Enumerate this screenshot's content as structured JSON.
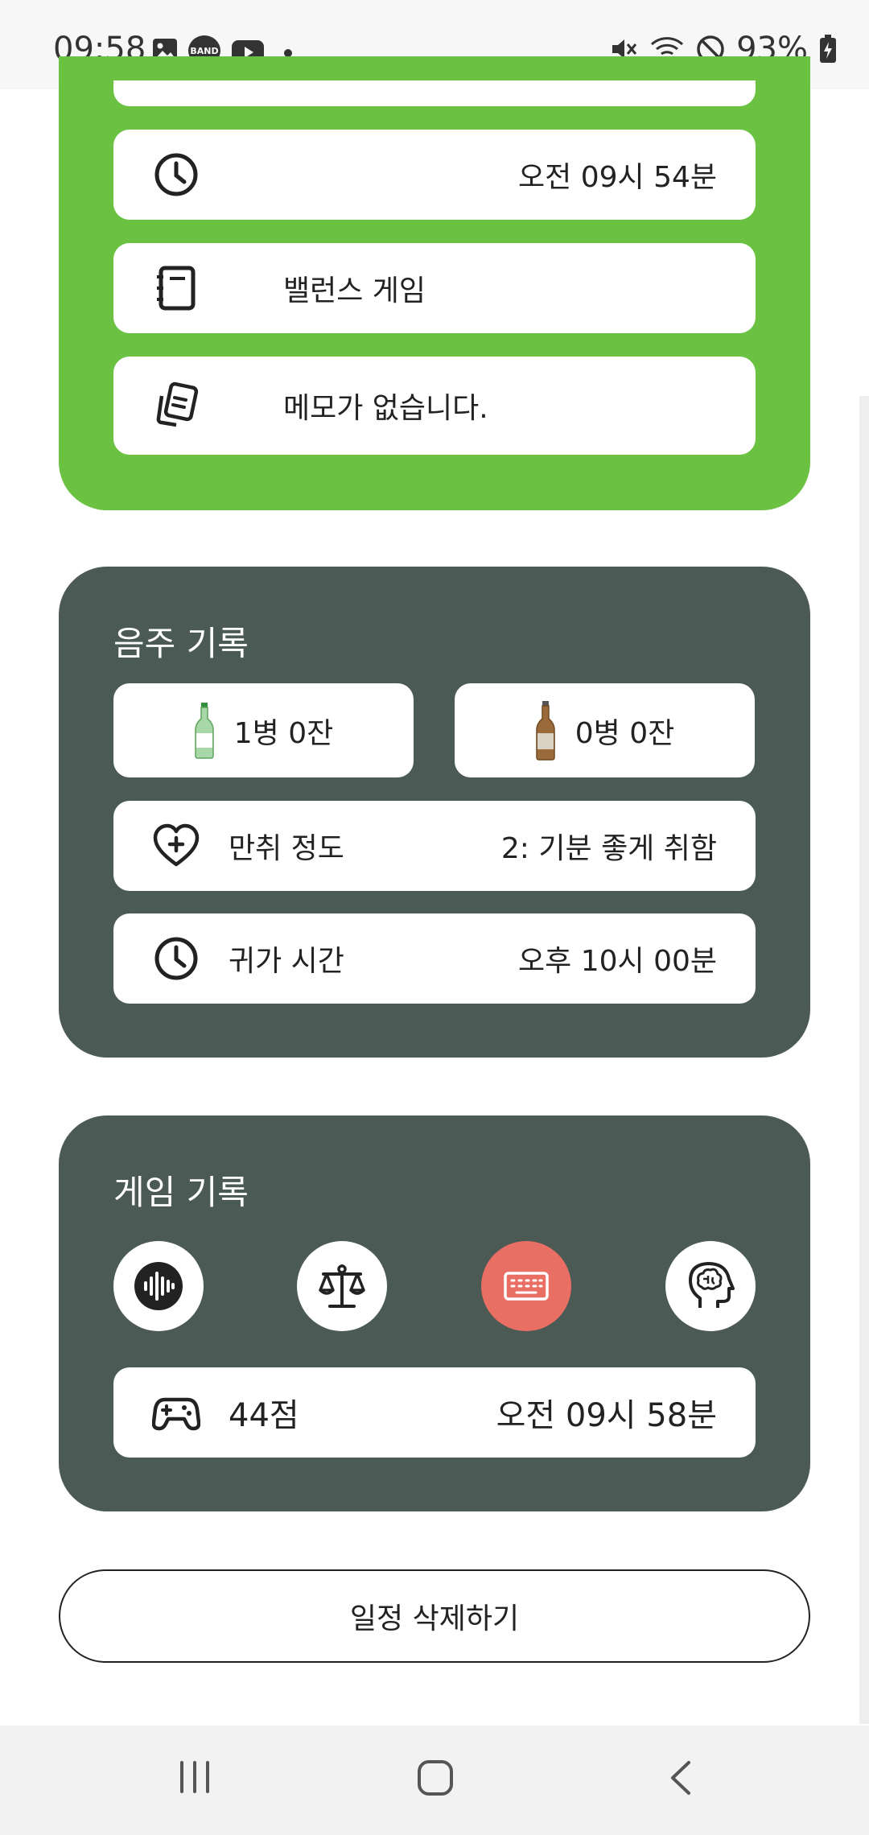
{
  "status_bar": {
    "time": "09:58",
    "band_label": "BAND",
    "battery": "93%"
  },
  "schedule": {
    "time_value": "오전 09시 54분",
    "game_value": "밸런스 게임",
    "memo_value": "메모가 없습니다."
  },
  "drink_record": {
    "title": "음주 기록",
    "soju_count": "1병 0잔",
    "beer_count": "0병 0잔",
    "drunk_label": "만취 정도",
    "drunk_value": "2: 기분 좋게 취함",
    "home_label": "귀가 시간",
    "home_value": "오후 10시 00분"
  },
  "game_record": {
    "title": "게임 기록",
    "score": "44점",
    "time": "오전 09시 58분",
    "active_color": "#e96e63"
  },
  "delete_button": "일정 삭제하기",
  "colors": {
    "green": "#6bc242",
    "dark_card": "#4c5a55"
  }
}
